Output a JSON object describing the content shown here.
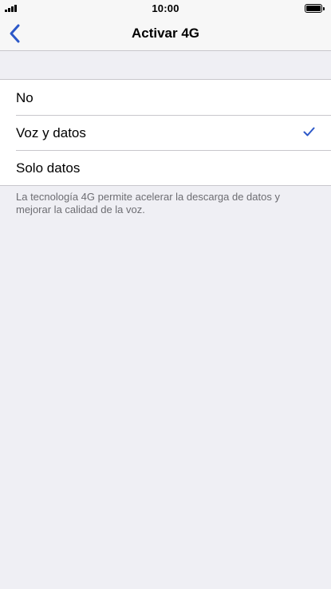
{
  "status_bar": {
    "time": "10:00",
    "signal_icon": "signal-bars-icon",
    "battery_icon": "battery-full-icon"
  },
  "nav": {
    "title": "Activar 4G",
    "back_icon": "chevron-left-icon",
    "accent_color": "#2c58c8"
  },
  "options": [
    {
      "label": "No",
      "selected": false
    },
    {
      "label": "Voz y datos",
      "selected": true
    },
    {
      "label": "Solo datos",
      "selected": false
    }
  ],
  "footnote": "La tecnología 4G permite acelerar la descarga de datos y mejorar la calidad de la voz."
}
